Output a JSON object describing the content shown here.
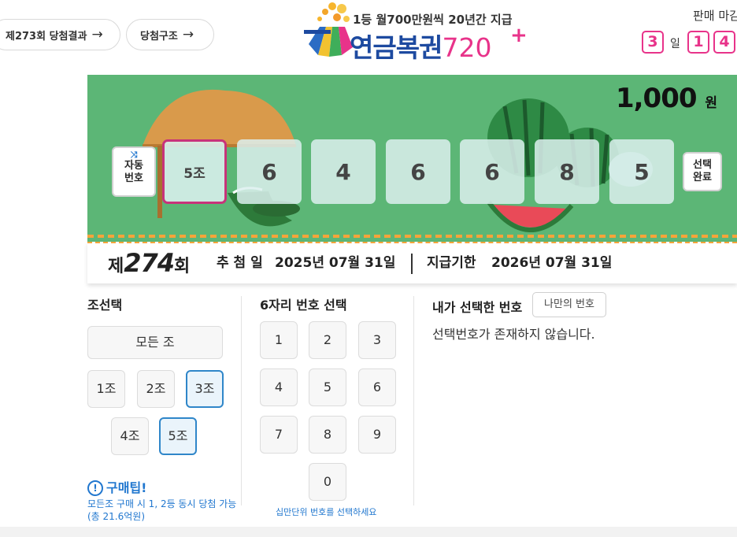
{
  "header": {
    "prev_result_label": "제273회 당첨결과",
    "structure_label": "당첨구조",
    "arrow": "→",
    "logo_sub": "1등 월700만원씩 20년간 지급",
    "logo_main": "연금복권",
    "logo_num": "720",
    "logo_plus": "+",
    "sale_label": "판매 마감",
    "countdown": {
      "days": "3",
      "day_unit": "일",
      "digit1": "1",
      "digit2": "4"
    }
  },
  "ticket": {
    "price": "1,000",
    "price_unit": "원",
    "auto_label_1": "자동",
    "auto_label_2": "번호",
    "jo": "5조",
    "digits": [
      "6",
      "4",
      "6",
      "6",
      "8",
      "5"
    ],
    "done_label_1": "선택",
    "done_label_2": "완료"
  },
  "draw": {
    "prefix": "제",
    "round": "274",
    "suffix": "회",
    "date_label": "추 첨 일",
    "date_value": "2025년 07월 31일",
    "deadline_label": "지급기한",
    "deadline_value": "2026년 07월 31일"
  },
  "jo_select": {
    "title": "조선택",
    "all": "모든 조",
    "options": [
      "1조",
      "2조",
      "3조",
      "4조",
      "5조"
    ]
  },
  "digit_select": {
    "title": "6자리 번호 선택",
    "numbers": [
      "1",
      "2",
      "3",
      "4",
      "5",
      "6",
      "7",
      "8",
      "9",
      "0"
    ],
    "hint": "십만단위 번호를 선택하세요"
  },
  "my_numbers": {
    "title": "내가 선택한 번호",
    "mine_button": "나만의 번호",
    "empty": "선택번호가 존재하지 않습니다."
  },
  "tip": {
    "icon": "!",
    "title": "구매팁!",
    "text": "모든조 구매 시 1, 2등 동시 당첨 가능(총 21.6억원)"
  },
  "colors": {
    "banner_green": "#5cb676",
    "accent_pink": "#e8338a",
    "logo_blue": "#1d4aa0",
    "selected_blue": "#2f86c9",
    "tip_blue": "#2177cf"
  }
}
